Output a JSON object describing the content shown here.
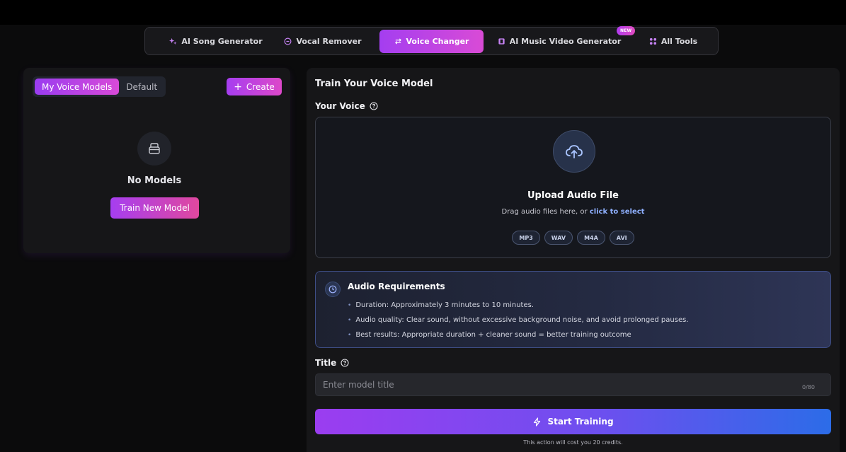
{
  "nav": {
    "items": [
      {
        "label": "AI Song Generator",
        "icon": "sparkle-icon"
      },
      {
        "label": "Vocal Remover",
        "icon": "circle-minus-icon"
      },
      {
        "label": "Voice Changer",
        "icon": "swap-arrows-icon",
        "active": true
      },
      {
        "label": "AI Music Video Generator",
        "icon": "film-icon"
      },
      {
        "label": "All Tools",
        "icon": "grid-icon"
      }
    ],
    "new_badge": "NEW"
  },
  "left": {
    "tabs": [
      "My Voice Models",
      "Default"
    ],
    "active_tab": "My Voice Models",
    "create_label": "Create",
    "empty_title": "No Models",
    "train_new_label": "Train New Model"
  },
  "right": {
    "title": "Train Your Voice Model",
    "voice_label": "Your Voice",
    "upload": {
      "title": "Upload Audio File",
      "sub_prefix": "Drag audio files here, or ",
      "sub_link": "click to select",
      "formats": [
        "MP3",
        "WAV",
        "M4A",
        "AVI"
      ]
    },
    "requirements": {
      "title": "Audio Requirements",
      "items": [
        "Duration: Approximately 3 minutes to 10 minutes.",
        "Audio quality: Clear sound, without excessive background noise, and avoid prolonged pauses.",
        "Best results: Appropriate duration + cleaner sound = better training outcome"
      ]
    },
    "title_label": "Title",
    "title_placeholder": "Enter model title",
    "title_counter": "0/80",
    "start_label": "Start Training",
    "cost_note": "This action will cost you 20 credits."
  },
  "colors": {
    "accent_purple": "#a63ef0",
    "accent_pink": "#dd48c9",
    "accent_blue": "#2c6ce8",
    "link_blue": "#8fb0ff"
  }
}
